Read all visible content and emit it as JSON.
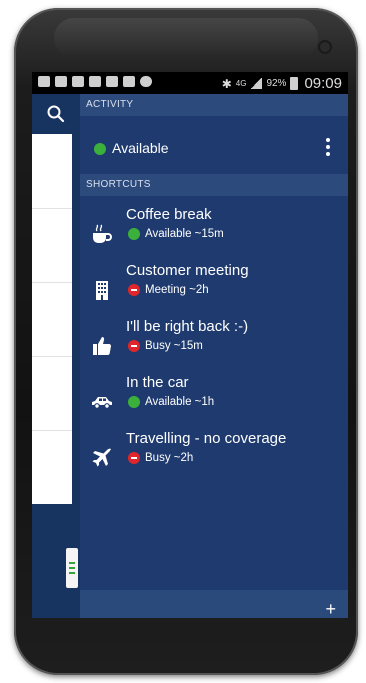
{
  "status_bar": {
    "battery_percent": "92%",
    "network": "4G",
    "time": "09:09"
  },
  "activity": {
    "header": "ACTIVITY",
    "current_status": "Available",
    "current_color": "#3bb13b"
  },
  "shortcuts": {
    "header": "SHORTCUTS",
    "items": [
      {
        "title": "Coffee break",
        "status": "Available ~15m",
        "icon": "coffee-icon",
        "status_type": "available"
      },
      {
        "title": "Customer meeting",
        "status": "Meeting ~2h",
        "icon": "building-icon",
        "status_type": "busy"
      },
      {
        "title": "I'll be right back :-)",
        "status": "Busy ~15m",
        "icon": "thumbs-up-icon",
        "status_type": "busy"
      },
      {
        "title": "In the car",
        "status": "Available ~1h",
        "icon": "car-icon",
        "status_type": "available"
      },
      {
        "title": "Travelling - no coverage",
        "status": "Busy ~2h",
        "icon": "airplane-icon",
        "status_type": "busy"
      }
    ]
  },
  "bottom_bar": {
    "add_label": "+"
  },
  "colors": {
    "panel_bg": "#1e3a6e",
    "header_bg": "#2d4a7c",
    "available": "#3bb13b",
    "busy": "#e0262b"
  }
}
